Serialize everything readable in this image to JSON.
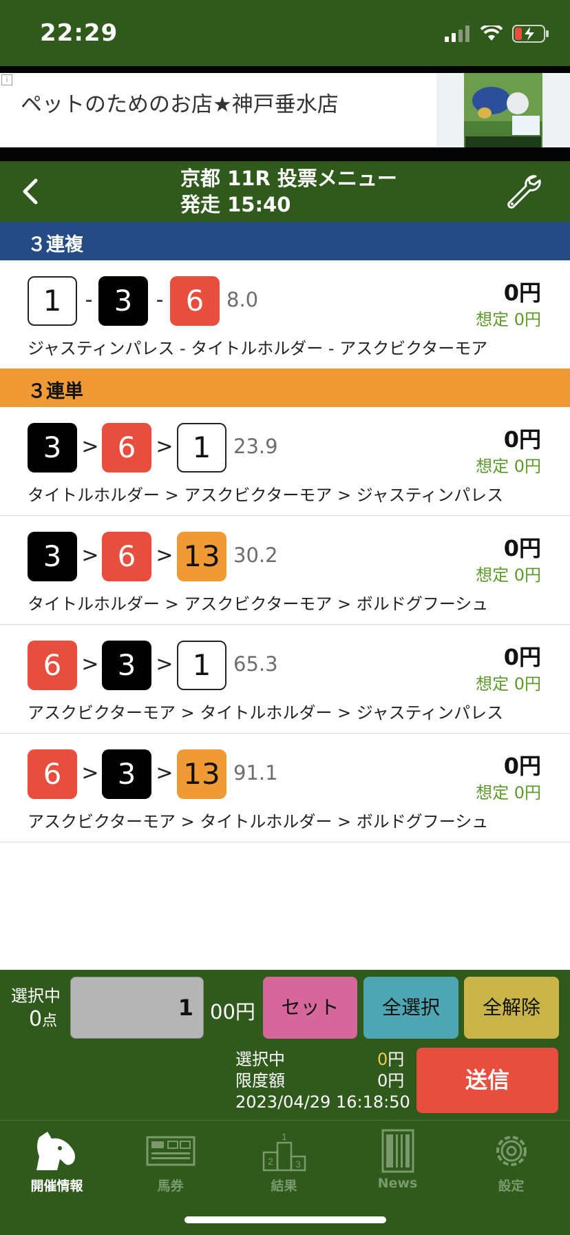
{
  "status_bar": {
    "time": "22:29"
  },
  "ad": {
    "text": "ペットのためのお店★神戸垂水店",
    "info_mark": "i"
  },
  "header": {
    "title_line1": "京都 11R 投票メニュー",
    "title_line2": "発走 15:40"
  },
  "sections": [
    {
      "title": "３連複",
      "color": "#244b84",
      "rows": [
        {
          "numbers": [
            "1",
            "3",
            "6"
          ],
          "separator": "-",
          "odds": "8.0",
          "amount": "0円",
          "expected_label": "想定",
          "expected_value": "0円",
          "names": "ジャスティンパレス - タイトルホルダー - アスクビクターモア"
        }
      ]
    },
    {
      "title": "３連単",
      "color": "#ef9a34",
      "rows": [
        {
          "numbers": [
            "3",
            "6",
            "1"
          ],
          "separator": ">",
          "odds": "23.9",
          "amount": "0円",
          "expected_label": "想定",
          "expected_value": "0円",
          "names": "タイトルホルダー > アスクビクターモア > ジャスティンパレス"
        },
        {
          "numbers": [
            "3",
            "6",
            "13"
          ],
          "separator": ">",
          "odds": "30.2",
          "amount": "0円",
          "expected_label": "想定",
          "expected_value": "0円",
          "names": "タイトルホルダー > アスクビクターモア > ボルドグフーシュ"
        },
        {
          "numbers": [
            "6",
            "3",
            "1"
          ],
          "separator": ">",
          "odds": "65.3",
          "amount": "0円",
          "expected_label": "想定",
          "expected_value": "0円",
          "names": "アスクビクターモア > タイトルホルダー > ジャスティンパレス"
        },
        {
          "numbers": [
            "6",
            "3",
            "13"
          ],
          "separator": ">",
          "odds": "91.1",
          "amount": "0円",
          "expected_label": "想定",
          "expected_value": "0円",
          "names": "アスクビクターモア > タイトルホルダー > ボルドグフーシュ"
        }
      ]
    }
  ],
  "bottom_panel": {
    "selected_label": "選択中",
    "selected_count": "0",
    "selected_unit": "点",
    "unit_value": "1",
    "unit_suffix": "00円",
    "set_button": "セット",
    "select_all_button": "全選択",
    "clear_all_button": "全解除",
    "info_selected_label": "選択中",
    "info_selected_value": "0",
    "info_selected_unit": "円",
    "limit_label": "限度額",
    "limit_value": "0円",
    "datetime": "2023/04/29 16:18:50",
    "send_button": "送信"
  },
  "tabs": [
    {
      "label": "開催情報",
      "icon": "horse-icon",
      "active": true
    },
    {
      "label": "馬券",
      "icon": "ticket-icon",
      "active": false
    },
    {
      "label": "結果",
      "icon": "podium-icon",
      "active": false
    },
    {
      "label": "News",
      "icon": "newspaper-icon",
      "active": false
    },
    {
      "label": "設定",
      "icon": "gear-icon",
      "active": false
    }
  ],
  "colors": {
    "header_green": "#2f5a1c",
    "box_black": "#000000",
    "box_red": "#e84e3d",
    "box_orange": "#ef9a34",
    "expected_green": "#5c9a2a",
    "send_red": "#e84e3d"
  }
}
